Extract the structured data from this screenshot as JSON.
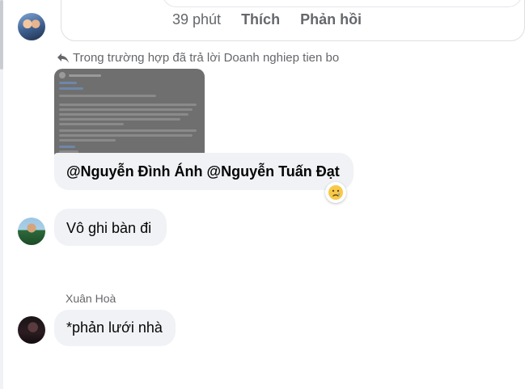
{
  "top_comment": {
    "time": "39 phút",
    "like_label": "Thích",
    "reply_label": "Phản hồi"
  },
  "reply_reference": {
    "text": "Trong trường hợp đã trả lời Doanh nghiep tien bo"
  },
  "messages": [
    {
      "text": "@Nguyễn Đình Ánh @Nguyễn Tuấn Đạt",
      "reaction": "sad-tear-emoji"
    },
    {
      "text": "Vô ghi bàn đi"
    },
    {
      "sender": "Xuân Hoà",
      "text": "*phản lưới nhà"
    }
  ],
  "colors": {
    "bubble_bg": "#f0f2f5",
    "meta_text": "#65676b",
    "primary_text": "#050505"
  }
}
